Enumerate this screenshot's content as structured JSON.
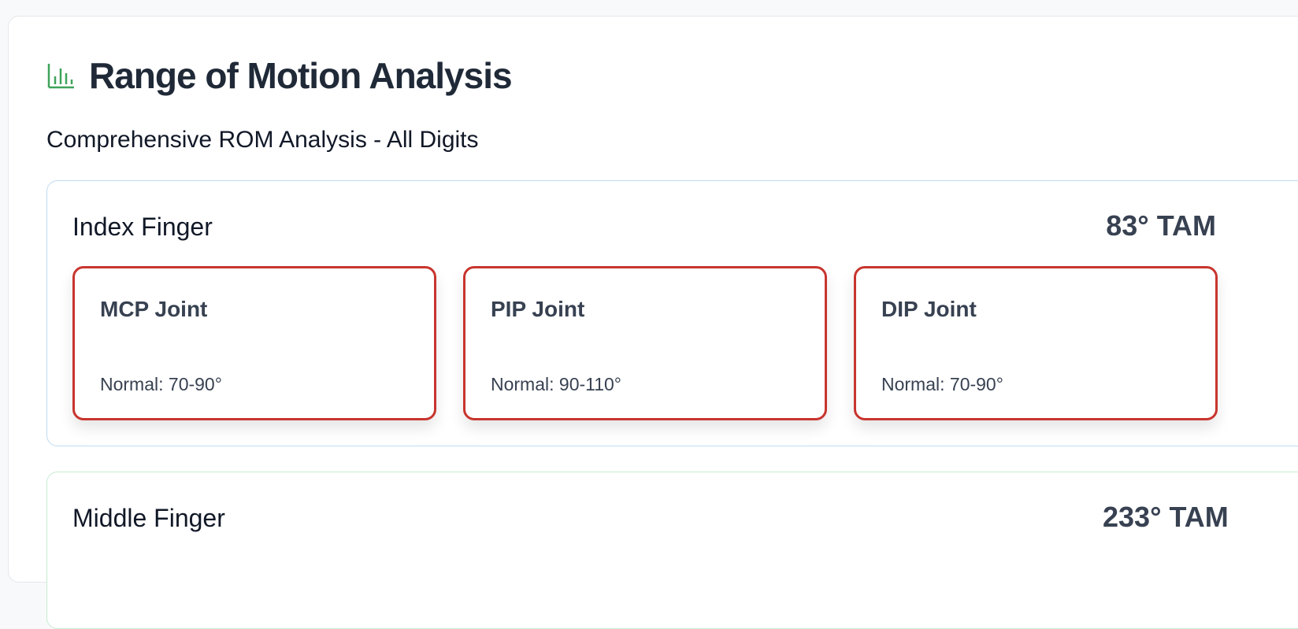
{
  "header": {
    "title": "Range of Motion Analysis",
    "icon": "bar-chart-icon",
    "icon_color": "#3fa35a"
  },
  "subtitle": "Comprehensive ROM Analysis - All Digits",
  "digits": [
    {
      "name": "Index Finger",
      "tam": "83° TAM",
      "border_color": "#bfdbf0",
      "joints": [
        {
          "name": "MCP Joint",
          "normal": "Normal: 70-90°"
        },
        {
          "name": "PIP Joint",
          "normal": "Normal: 90-110°"
        },
        {
          "name": "DIP Joint",
          "normal": "Normal: 70-90°"
        }
      ],
      "joint_border_color": "#c8352e"
    },
    {
      "name": "Middle Finger",
      "tam": "233° TAM",
      "border_color": "#c6ecd0"
    }
  ]
}
